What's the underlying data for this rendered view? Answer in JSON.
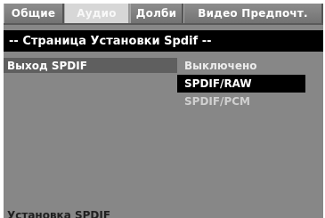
{
  "tabs": [
    {
      "label": "Общие",
      "active": false
    },
    {
      "label": "Аудио",
      "active": true
    },
    {
      "label": "Долби",
      "active": false
    },
    {
      "label": "Видео Предпочт.",
      "active": false
    }
  ],
  "header": {
    "title": "-- Страница Установки Spdif --"
  },
  "settings": {
    "item_label": "Выход SPDIF",
    "options": [
      {
        "label": "Выключено",
        "selected": false
      },
      {
        "label": "SPDIF/RAW",
        "selected": true
      },
      {
        "label": "SPDIF/PCM",
        "selected": false
      }
    ]
  },
  "footer": {
    "text": "Установка SPDIF"
  },
  "colors": {
    "background": "#878787",
    "highlight": "#000000",
    "active_tab": "#d7d7d7",
    "row_highlight": "#5f5f5f"
  }
}
